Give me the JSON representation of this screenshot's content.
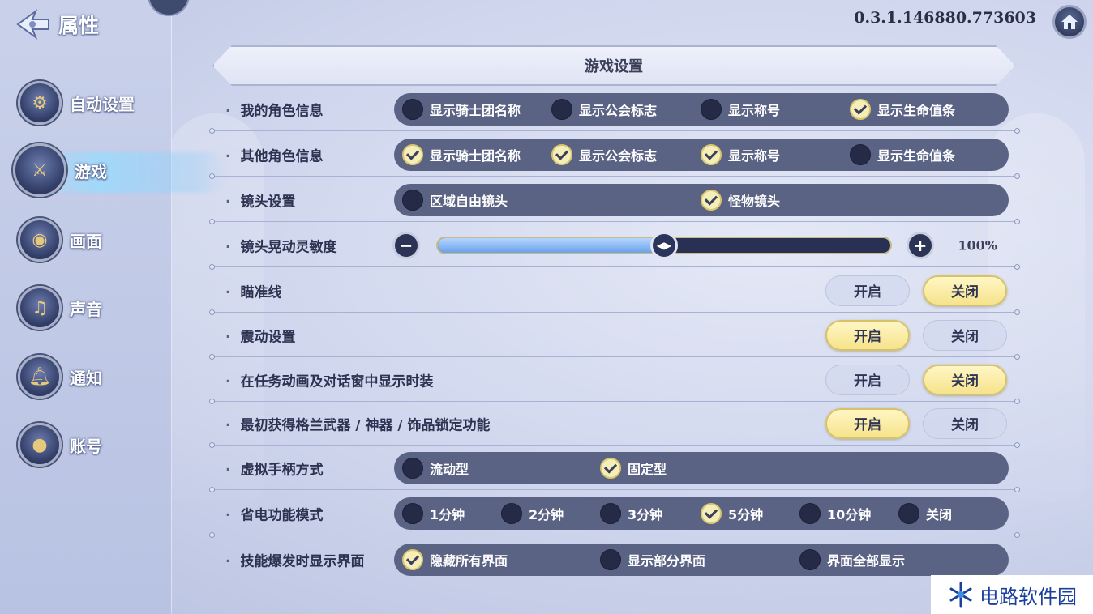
{
  "header": {
    "title": "属性",
    "version": "0.3.1.146880.773603"
  },
  "sidebar": {
    "items": [
      {
        "label": "自动设置",
        "icon": "auto-settings-icon",
        "active": false
      },
      {
        "label": "游戏",
        "icon": "crossed-swords-icon",
        "active": true
      },
      {
        "label": "画面",
        "icon": "eye-icon",
        "active": false
      },
      {
        "label": "声音",
        "icon": "music-note-icon",
        "active": false
      },
      {
        "label": "通知",
        "icon": "bell-icon",
        "active": false
      },
      {
        "label": "账号",
        "icon": "user-icon",
        "active": false
      }
    ]
  },
  "section": {
    "title": "游戏设置"
  },
  "settings": {
    "my_char": {
      "label": "我的角色信息",
      "options": [
        {
          "label": "显示骑士团名称",
          "checked": false
        },
        {
          "label": "显示公会标志",
          "checked": false
        },
        {
          "label": "显示称号",
          "checked": false
        },
        {
          "label": "显示生命值条",
          "checked": true
        }
      ]
    },
    "other_char": {
      "label": "其他角色信息",
      "options": [
        {
          "label": "显示骑士团名称",
          "checked": true
        },
        {
          "label": "显示公会标志",
          "checked": true
        },
        {
          "label": "显示称号",
          "checked": true
        },
        {
          "label": "显示生命值条",
          "checked": false
        }
      ]
    },
    "camera": {
      "label": "镜头设置",
      "options": [
        {
          "label": "区域自由镜头",
          "checked": false
        },
        {
          "label": "怪物镜头",
          "checked": true
        }
      ]
    },
    "shake": {
      "label": "镜头晃动灵敏度",
      "value_text": "100%",
      "fill_fraction": 0.5
    },
    "crosshair": {
      "label": "瞄准线",
      "on": "开启",
      "off": "关闭",
      "selected": "off"
    },
    "vibration": {
      "label": "震动设置",
      "on": "开启",
      "off": "关闭",
      "selected": "on"
    },
    "costume": {
      "label": "在任务动画及对话窗中显示时装",
      "on": "开启",
      "off": "关闭",
      "selected": "off"
    },
    "weapon_lock": {
      "label": "最初获得格兰武器 / 神器 / 饰品锁定功能",
      "on": "开启",
      "off": "关闭",
      "selected": "on"
    },
    "joystick": {
      "label": "虚拟手柄方式",
      "options": [
        {
          "label": "流动型",
          "checked": false
        },
        {
          "label": "固定型",
          "checked": true
        }
      ]
    },
    "power_save": {
      "label": "省电功能模式",
      "options": [
        {
          "label": "1分钟",
          "checked": false
        },
        {
          "label": "2分钟",
          "checked": false
        },
        {
          "label": "3分钟",
          "checked": false
        },
        {
          "label": "5分钟",
          "checked": true
        },
        {
          "label": "10分钟",
          "checked": false
        },
        {
          "label": "关闭",
          "checked": false
        }
      ]
    },
    "skill_burst": {
      "label": "技能爆发时显示界面",
      "options": [
        {
          "label": "隐藏所有界面",
          "checked": true
        },
        {
          "label": "显示部分界面",
          "checked": false
        },
        {
          "label": "界面全部显示",
          "checked": false
        }
      ]
    }
  },
  "watermark": {
    "text": "电路软件园"
  },
  "colors": {
    "toggle_selected": "#f6e38c",
    "option_bar": "#5b6384",
    "slider_fill": "#6aa2ea"
  }
}
